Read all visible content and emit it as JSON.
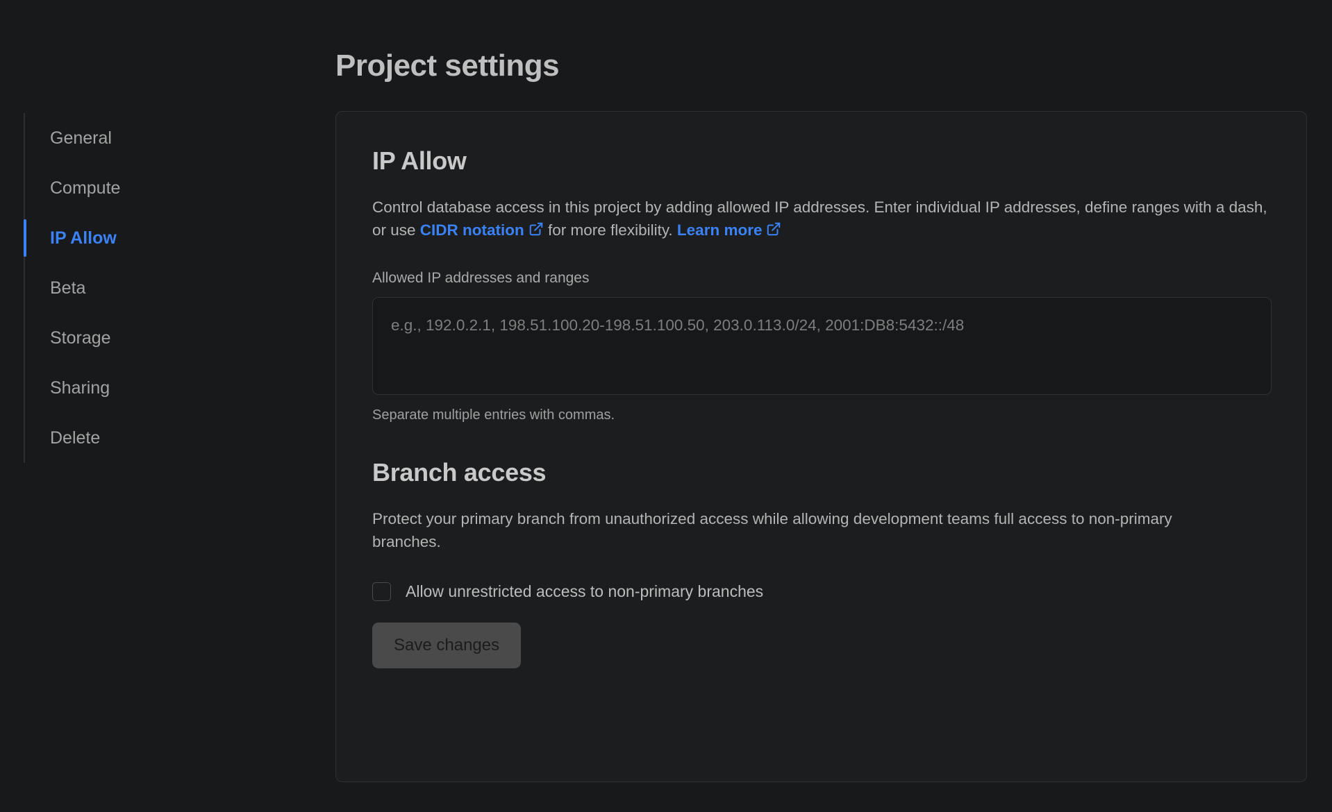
{
  "page": {
    "title": "Project settings"
  },
  "sidebar": {
    "items": [
      {
        "label": "General",
        "active": false
      },
      {
        "label": "Compute",
        "active": false
      },
      {
        "label": "IP Allow",
        "active": true
      },
      {
        "label": "Beta",
        "active": false
      },
      {
        "label": "Storage",
        "active": false
      },
      {
        "label": "Sharing",
        "active": false
      },
      {
        "label": "Delete",
        "active": false
      }
    ]
  },
  "ip_allow": {
    "heading": "IP Allow",
    "description_part1": "Control database access in this project by adding allowed IP addresses. Enter individual IP addresses, define ranges with a dash, or use ",
    "cidr_link_label": "CIDR notation",
    "description_part2": " for more flexibility. ",
    "learn_more_label": "Learn more",
    "field_label": "Allowed IP addresses and ranges",
    "textarea_value": "",
    "textarea_placeholder": "e.g., 192.0.2.1, 198.51.100.20-198.51.100.50, 203.0.113.0/24, 2001:DB8:5432::/48",
    "helper_text": "Separate multiple entries with commas."
  },
  "branch_access": {
    "heading": "Branch access",
    "description": "Protect your primary branch from unauthorized access while allowing development teams full access to non-primary branches.",
    "checkbox_label": "Allow unrestricted access to non-primary branches",
    "checkbox_checked": false,
    "save_label": "Save changes"
  },
  "colors": {
    "background": "#18191a",
    "card_background": "#1c1d1e",
    "accent_blue": "#3b82f6",
    "text_primary": "#c9c9c9",
    "text_secondary": "#a9a9a9",
    "button_background": "#4a4a4a"
  }
}
